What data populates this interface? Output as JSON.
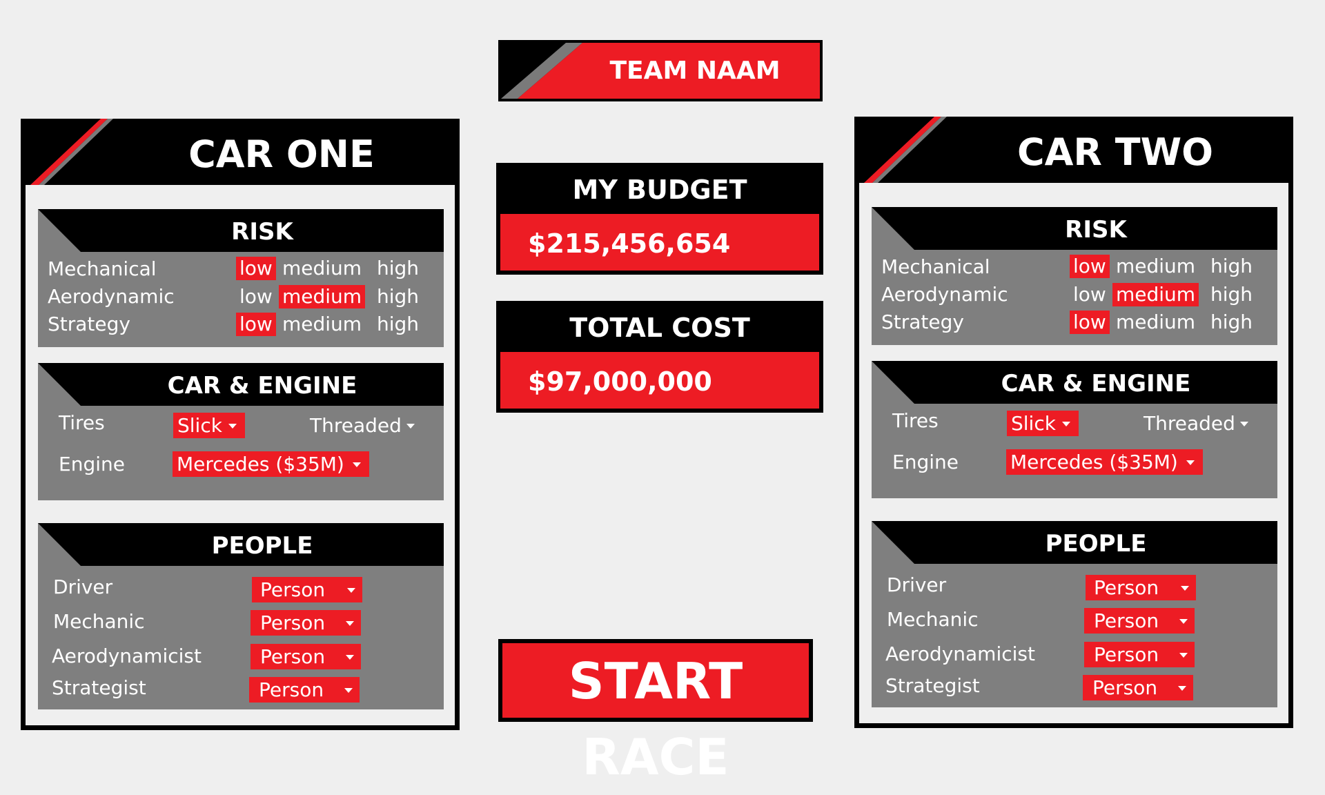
{
  "team": {
    "name": "TEAM NAAM"
  },
  "budget": {
    "label": "MY BUDGET",
    "value": "$215,456,654"
  },
  "cost": {
    "label": "TOTAL COST",
    "value": "$97,000,000"
  },
  "start_button": {
    "label": "START RACE"
  },
  "colors": {
    "accent": "#ed1c24",
    "panel": "#000000",
    "section_bg": "#7f7f7f",
    "page_bg": "#efefef",
    "stripe_grey": "#7a7a7a"
  },
  "cars": [
    {
      "title": "CAR ONE",
      "risk": {
        "title": "RISK",
        "levels": [
          "low",
          "medium",
          "high"
        ],
        "rows": [
          {
            "label": "Mechanical",
            "selected": "low"
          },
          {
            "label": "Aerodynamic",
            "selected": "medium"
          },
          {
            "label": "Strategy",
            "selected": "low"
          }
        ]
      },
      "car_engine": {
        "title": "CAR & ENGINE",
        "tires_label": "Tires",
        "tires_selected": "Slick",
        "tires_other": "Threaded",
        "engine_label": "Engine",
        "engine_value": "Mercedes ($35M)"
      },
      "people": {
        "title": "PEOPLE",
        "rows": [
          {
            "label": "Driver",
            "value": "Person"
          },
          {
            "label": "Mechanic",
            "value": "Person"
          },
          {
            "label": "Aerodynamicist",
            "value": "Person"
          },
          {
            "label": "Strategist",
            "value": "Person"
          }
        ]
      }
    },
    {
      "title": "CAR TWO",
      "risk": {
        "title": "RISK",
        "levels": [
          "low",
          "medium",
          "high"
        ],
        "rows": [
          {
            "label": "Mechanical",
            "selected": "low"
          },
          {
            "label": "Aerodynamic",
            "selected": "medium"
          },
          {
            "label": "Strategy",
            "selected": "low"
          }
        ]
      },
      "car_engine": {
        "title": "CAR & ENGINE",
        "tires_label": "Tires",
        "tires_selected": "Slick",
        "tires_other": "Threaded",
        "engine_label": "Engine",
        "engine_value": "Mercedes ($35M)"
      },
      "people": {
        "title": "PEOPLE",
        "rows": [
          {
            "label": "Driver",
            "value": "Person"
          },
          {
            "label": "Mechanic",
            "value": "Person"
          },
          {
            "label": "Aerodynamicist",
            "value": "Person"
          },
          {
            "label": "Strategist",
            "value": "Person"
          }
        ]
      }
    }
  ]
}
